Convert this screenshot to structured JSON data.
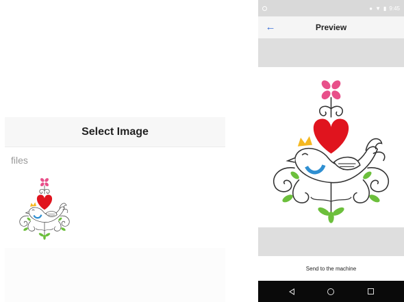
{
  "left": {
    "title": "Select Image",
    "files_label": "files",
    "thumbnail_icon": "folk-bird-heart-embroidery"
  },
  "right": {
    "status": {
      "time": "9:45",
      "icons": [
        "settings-icon",
        "signal-icon",
        "wifi-icon",
        "battery-icon"
      ]
    },
    "appbar": {
      "back_icon": "arrow-back-icon",
      "title": "Preview"
    },
    "preview_icon": "folk-bird-heart-embroidery",
    "send_label": "Send to the machine",
    "nav": [
      "back",
      "home",
      "recents"
    ]
  },
  "colors": {
    "heart": "#e0141e",
    "flower": "#e8508a",
    "crown": "#f5b820",
    "wing": "#2f8fd1",
    "leaf": "#6cbf3c",
    "line": "#333333",
    "back_arrow": "#3b6fd8"
  }
}
